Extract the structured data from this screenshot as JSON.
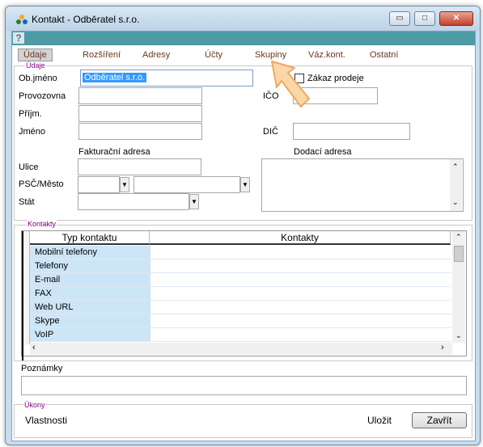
{
  "window": {
    "title": "Kontakt - Odběratel s.r.o.",
    "help_glyph": "?",
    "caption_min": "▭",
    "caption_max": "□",
    "caption_close": "✕"
  },
  "tabs": [
    {
      "label": "Údaje",
      "active": true
    },
    {
      "label": "Rozšíření"
    },
    {
      "label": "Adresy"
    },
    {
      "label": "Účty"
    },
    {
      "label": "Skupiny"
    },
    {
      "label": "Váz.kont."
    },
    {
      "label": "Ostatní"
    }
  ],
  "udaje": {
    "group_label": "Údaje",
    "obj_label": "Ob.jméno",
    "obj_value": "Odběratel s.r.o.",
    "provozovna_label": "Provozovna",
    "prijm_label": "Příjm.",
    "jmeno_label": "Jméno",
    "zakaz_label": "Zákaz prodeje",
    "ico_label": "IČO",
    "dic_label": "DIČ",
    "fakturacni_label": "Fakturační adresa",
    "dodaci_label": "Dodací adresa",
    "ulice_label": "Ulice",
    "psc_label": "PSČ/Město",
    "stat_label": "Stát"
  },
  "kontakty": {
    "group_label": "Kontakty",
    "col_type": "Typ kontaktu",
    "col_value": "Kontakty",
    "rows": [
      "Mobilní telefony",
      "Telefony",
      "E-mail",
      "FAX",
      "Web URL",
      "Skype",
      "VoIP"
    ]
  },
  "poznamky_label": "Poznámky",
  "ukony": {
    "group_label": "Úkony",
    "vlastnosti": "Vlastnosti",
    "ulozit": "Uložit",
    "zavrit": "Zavřít"
  },
  "colors": {
    "accent_help_bar": "#4e9aa5",
    "selection": "#3399ff",
    "group_label": "#800080",
    "tab_text": "#6a3820"
  }
}
